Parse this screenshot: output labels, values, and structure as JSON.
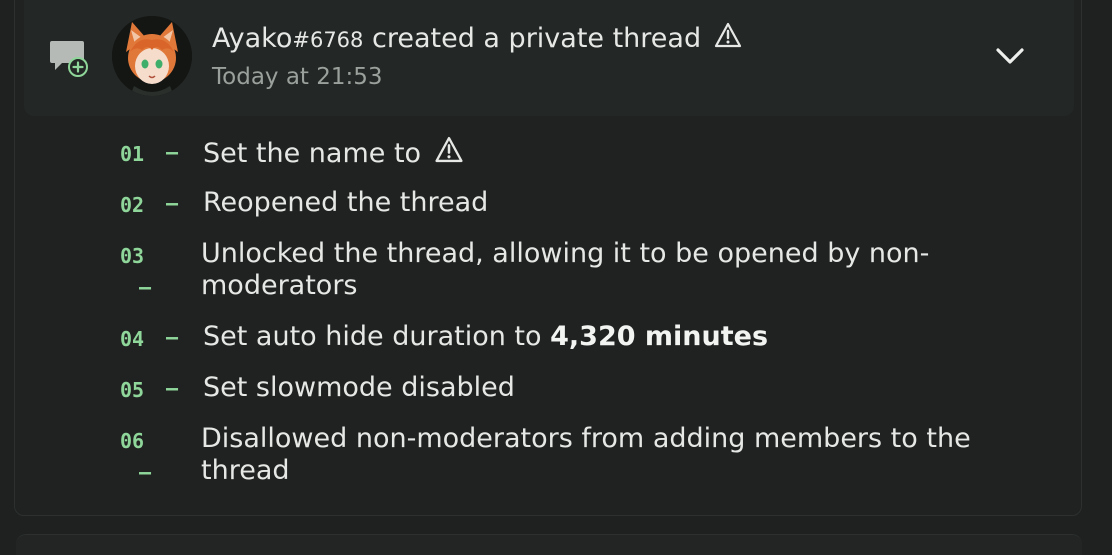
{
  "thread_event": {
    "username": "Ayako",
    "discriminator": "#6768",
    "action": "created a private thread",
    "timestamp": "Today at 21:53",
    "expanded_icon": "chevron-down-icon",
    "thread_icon": "thread-created-icon"
  },
  "changes": [
    {
      "num": "01",
      "dash": "–",
      "text": "Set the name to",
      "suffix": "⚠"
    },
    {
      "num": "02",
      "dash": "–",
      "text": "Reopened the thread"
    },
    {
      "num": "03",
      "dash": "–",
      "line1": "Unlocked the thread, allowing it to be opened by non-",
      "line2": "moderators"
    },
    {
      "num": "04",
      "dash": "–",
      "text": "Set auto hide duration to",
      "bold": "4,320 minutes"
    },
    {
      "num": "05",
      "dash": "–",
      "text": "Set slowmode disabled"
    },
    {
      "num": "06",
      "dash": "–",
      "line1": "Disallowed non-moderators from adding members to the",
      "line2": "thread"
    }
  ],
  "colors": {
    "background": "#1e211f",
    "header_bg": "#232725",
    "accent_green": "#8fd69a",
    "text": "#e6e8e6",
    "muted": "#9aa09c"
  }
}
